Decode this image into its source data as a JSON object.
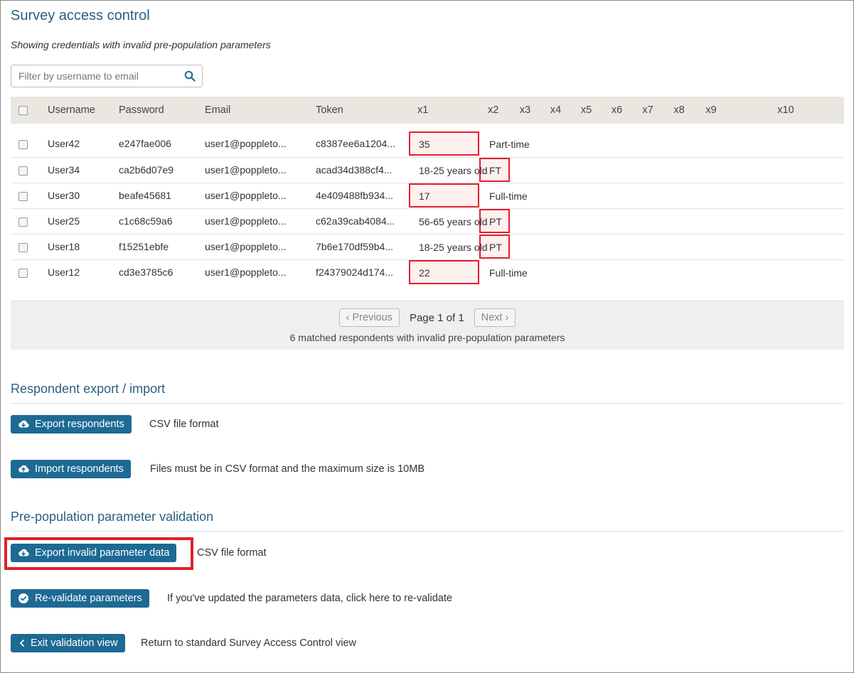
{
  "page": {
    "title": "Survey access control",
    "subtitle": "Showing credentials with invalid pre-population parameters"
  },
  "search": {
    "placeholder": "Filter by username to email"
  },
  "table": {
    "columns": [
      "Username",
      "Password",
      "Email",
      "Token",
      "x1",
      "x2",
      "x3",
      "x4",
      "x5",
      "x6",
      "x7",
      "x8",
      "x9",
      "x10"
    ],
    "rows": [
      {
        "username": "User42",
        "password": "e247fae006",
        "email": "user1@poppleto...",
        "token": "c8387ee6a1204...",
        "x1": "35",
        "x1_invalid": true,
        "x2": "Part-time",
        "x2_invalid": false
      },
      {
        "username": "User34",
        "password": "ca2b6d07e9",
        "email": "user1@poppleto...",
        "token": "acad34d388cf4...",
        "x1": "18-25 years old",
        "x1_invalid": false,
        "x2": "FT",
        "x2_invalid": true
      },
      {
        "username": "User30",
        "password": "beafe45681",
        "email": "user1@poppleto...",
        "token": "4e409488fb934...",
        "x1": "17",
        "x1_invalid": true,
        "x2": "Full-time",
        "x2_invalid": false
      },
      {
        "username": "User25",
        "password": "c1c68c59a6",
        "email": "user1@poppleto...",
        "token": "c62a39cab4084...",
        "x1": "56-65 years old",
        "x1_invalid": false,
        "x2": "PT",
        "x2_invalid": true
      },
      {
        "username": "User18",
        "password": "f15251ebfe",
        "email": "user1@poppleto...",
        "token": "7b6e170df59b4...",
        "x1": "18-25 years old",
        "x1_invalid": false,
        "x2": "PT",
        "x2_invalid": true
      },
      {
        "username": "User12",
        "password": "cd3e3785c6",
        "email": "user1@poppleto...",
        "token": "f24379024d174...",
        "x1": "22",
        "x1_invalid": true,
        "x2": "Full-time",
        "x2_invalid": false
      }
    ]
  },
  "pagination": {
    "previous_label": "‹ Previous",
    "page_text": "Page 1 of 1",
    "next_label": "Next ›",
    "summary": "6 matched respondents with invalid pre-population parameters"
  },
  "export_import": {
    "title": "Respondent export / import",
    "export_label": "Export respondents",
    "export_desc": "CSV file format",
    "import_label": "Import respondents",
    "import_desc": "Files must be in CSV format and the maximum size is 10MB"
  },
  "validation": {
    "title": "Pre-population parameter validation",
    "export_invalid_label": "Export invalid parameter data",
    "export_invalid_desc": "CSV file format",
    "revalidate_label": "Re-validate parameters",
    "revalidate_desc": "If you've updated the parameters data, click here to re-validate",
    "exit_label": "Exit validation view",
    "exit_desc": "Return to standard Survey Access Control view"
  },
  "colors": {
    "accent": "#1d6a94",
    "title": "#2a5f80",
    "invalid_border": "#e0202c",
    "invalid_fill": "#fff0f0",
    "header_bg": "#e9e7e0"
  },
  "icons": {
    "search": "search-icon",
    "export": "cloud-download-icon",
    "import": "cloud-upload-icon",
    "revalidate": "check-circle-icon",
    "exit": "chevron-left-icon"
  }
}
